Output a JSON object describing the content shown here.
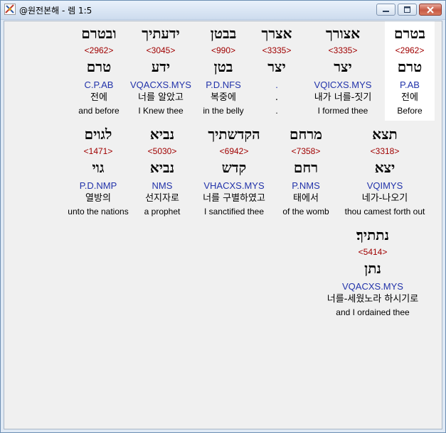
{
  "window": {
    "title": "@원전본해 - 렘 1:5"
  },
  "rows": [
    [
      {
        "heb": "ובטרם",
        "strong": "<2962>",
        "root": "טרם",
        "morph": "C.P.AB",
        "kor": "전에",
        "eng": "and before"
      },
      {
        "heb": "ידעתיך",
        "strong": "<3045>",
        "root": "ידע",
        "morph": "VQACXS.MYS",
        "kor": "너를 알았고",
        "eng": "I Knew thee"
      },
      {
        "heb": "בבטן",
        "strong": "<990>",
        "root": "בטן",
        "morph": "P.D.NFS",
        "kor": "복중에",
        "eng": "in the belly"
      },
      {
        "heb": "אצרך",
        "strong": "<3335>",
        "root": "יצר",
        "morph": ".",
        "kor": ".",
        "eng": "."
      },
      {
        "heb": "אצורך",
        "strong": "<3335>",
        "root": "יצר",
        "morph": "VQICXS.MYS",
        "kor": "내가 너를-짓기",
        "eng": "I formed thee"
      },
      {
        "heb": "בטרם",
        "strong": "<2962>",
        "root": "טרם",
        "morph": "P.AB",
        "kor": "전에",
        "eng": "Before"
      }
    ],
    [
      {
        "heb": "לגוים",
        "strong": "<1471>",
        "root": "גוי",
        "morph": "P.D.NMP",
        "kor": "열방의",
        "eng": "unto the nations"
      },
      {
        "heb": "נביא",
        "strong": "<5030>",
        "root": "נביא",
        "morph": "NMS",
        "kor": "선지자로",
        "eng": "a prophet"
      },
      {
        "heb": "הקדשתיך",
        "strong": "<6942>",
        "root": "קדש",
        "morph": "VHACXS.MYS",
        "kor": "너를 구별하였고",
        "eng": "I sanctified thee"
      },
      {
        "heb": "מרחם",
        "strong": "<7358>",
        "root": "רחם",
        "morph": "P.NMS",
        "kor": "태에서",
        "eng": "of the womb"
      },
      {
        "heb": "תצא",
        "strong": "<3318>",
        "root": "יצא",
        "morph": "VQIMYS",
        "kor": "네가-나오기",
        "eng": "thou camest forth out"
      }
    ],
    [
      {
        "heb": "נתתיך׃",
        "strong": "<5414>",
        "root": "נתן",
        "morph": "VQACXS.MYS",
        "kor": "너를-세웠노라 하시기로",
        "eng": "and I ordained thee"
      }
    ]
  ]
}
